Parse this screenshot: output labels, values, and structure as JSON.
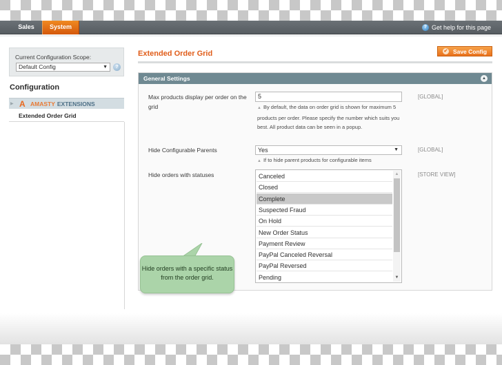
{
  "nav": {
    "items": [
      {
        "label": "Sales",
        "active": false
      },
      {
        "label": "System",
        "active": true
      }
    ],
    "help_label": "Get help for this page"
  },
  "sidebar": {
    "scope_label": "Current Configuration Scope:",
    "scope_value": "Default Config",
    "section_title": "Configuration",
    "group": {
      "brand": "AMASTY",
      "suffix": "EXTENSIONS"
    },
    "items": [
      {
        "label": "Extended Order Grid"
      }
    ]
  },
  "main": {
    "title": "Extended Order Grid",
    "save_label": "Save Config",
    "fieldset_title": "General Settings",
    "fields": [
      {
        "label": "Max products display per order on the grid",
        "value": "5",
        "note": "By default, the data on order grid is shown for maximum 5 products per order. Please specify the number which suits you best. All product data can be seen in a popup.",
        "scope": "[GLOBAL]"
      },
      {
        "label": "Hide Configurable Parents",
        "value": "Yes",
        "note": "If to hide parent products for configurable items",
        "scope": "[GLOBAL]"
      },
      {
        "label": "Hide orders with statuses",
        "scope": "[STORE VIEW]",
        "options": [
          {
            "label": "Canceled",
            "selected": false
          },
          {
            "label": "Closed",
            "selected": false
          },
          {
            "label": "Complete",
            "selected": true
          },
          {
            "label": "Suspected Fraud",
            "selected": false
          },
          {
            "label": "On Hold",
            "selected": false
          },
          {
            "label": "New Order Status",
            "selected": false
          },
          {
            "label": "Payment Review",
            "selected": false
          },
          {
            "label": "PayPal Canceled Reversal",
            "selected": false
          },
          {
            "label": "PayPal Reversed",
            "selected": false
          },
          {
            "label": "Pending",
            "selected": false
          }
        ]
      }
    ]
  },
  "callout": {
    "text": "Hide orders with a specific status from the order grid."
  },
  "colors": {
    "accent": "#e9711c",
    "nav_bg": "#5f656a",
    "fieldset_header": "#6f8992",
    "callout_bg": "#abd4a9"
  }
}
